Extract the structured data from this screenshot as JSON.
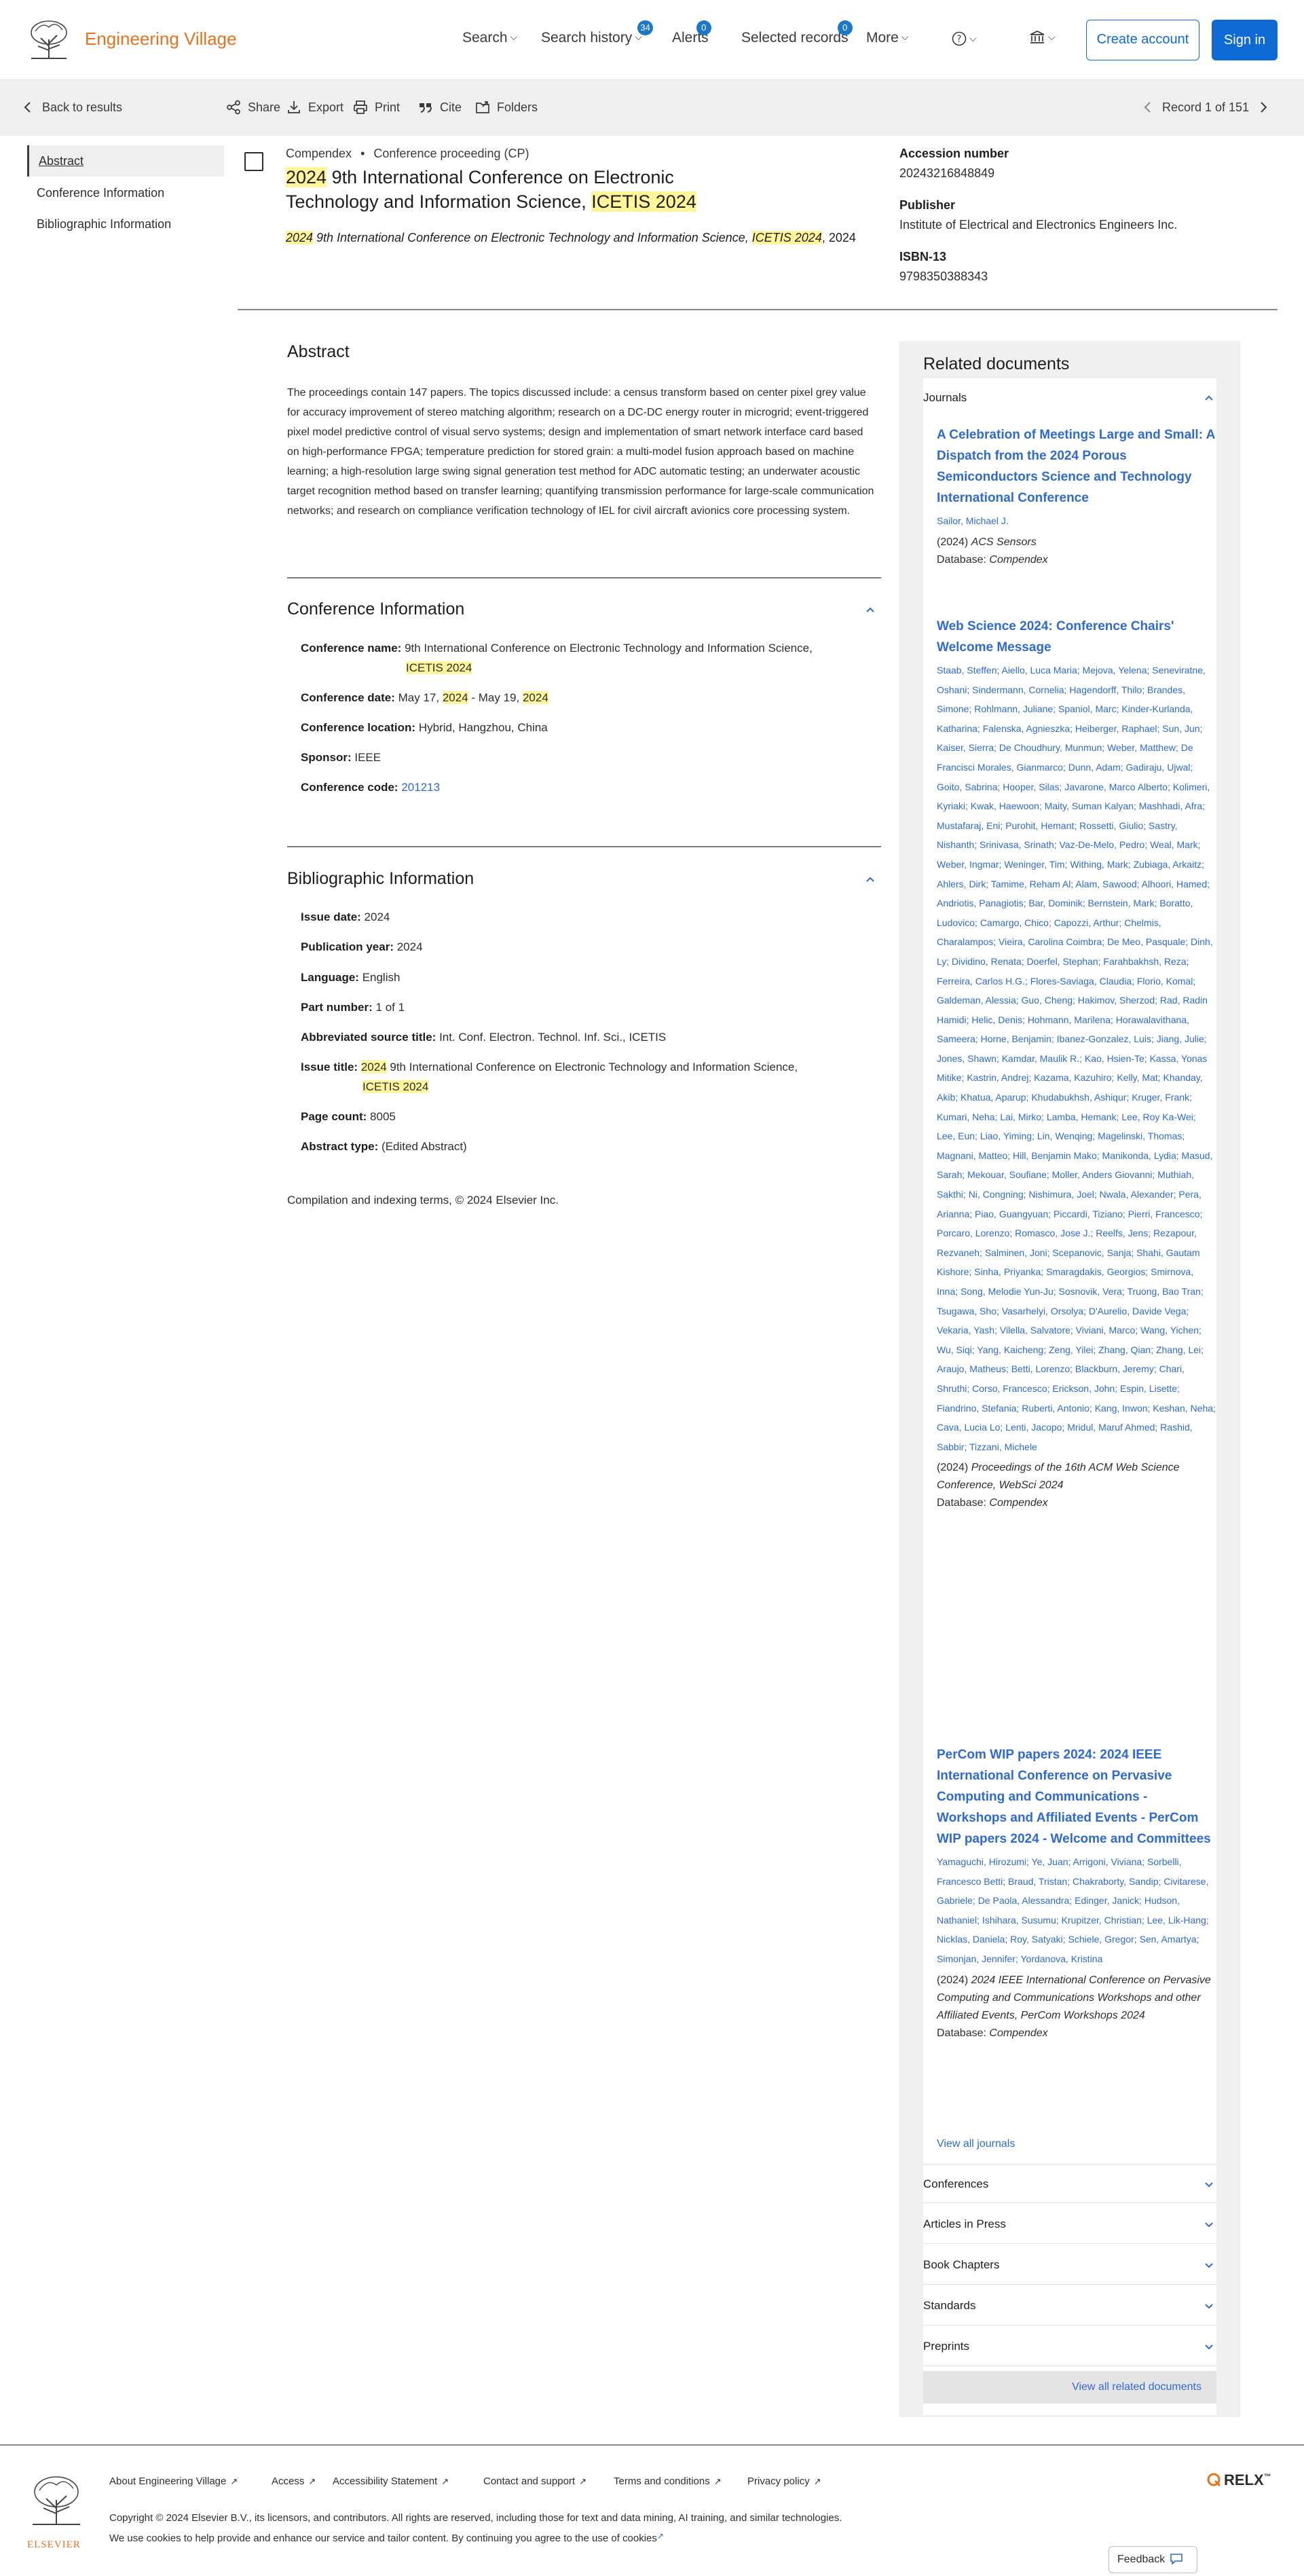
{
  "header": {
    "brand": "Engineering Village",
    "nav": {
      "search": "Search",
      "history": "Search history",
      "history_count": "34",
      "alerts": "Alerts",
      "alerts_count": "0",
      "selected": "Selected records",
      "selected_count": "0",
      "more": "More"
    },
    "create_account": "Create account",
    "sign_in": "Sign in"
  },
  "toolbar": {
    "back": "Back to results",
    "share": "Share",
    "export": "Export",
    "print": "Print",
    "cite": "Cite",
    "folders": "Folders",
    "record": "Record 1 of 151"
  },
  "sidebar": {
    "items": [
      "Abstract",
      "Conference Information",
      "Bibliographic Information"
    ]
  },
  "record": {
    "database": "Compendex",
    "sep": "•",
    "doc_type": "Conference proceeding (CP)",
    "title_hl1": "2024",
    "title_a": " 9th International Conference on Electronic Technology and Information Science, ",
    "title_hl2": "ICETIS 2024",
    "source_hl1": "2024",
    "source_a": " 9th International Conference on Electronic Technology and Information Science, ",
    "source_hl2": "ICETIS 2024",
    "source_b": ", 2024",
    "accession_label": "Accession number",
    "accession_value": "20243216848849",
    "publisher_label": "Publisher",
    "publisher_value": "Institute of Electrical and Electronics Engineers Inc.",
    "isbn_label": "ISBN-13",
    "isbn_value": "9798350388343"
  },
  "abstract": {
    "heading": "Abstract",
    "text": "The proceedings contain 147 papers. The topics discussed include: a census transform based on center pixel grey value for accuracy improvement of stereo matching algorithm; research on a DC-DC energy router in microgrid; event-triggered pixel model predictive control of visual servo systems; design and implementation of smart network interface card based on high-performance FPGA; temperature prediction for stored grain: a multi-model fusion approach based on machine learning; a high-resolution large swing signal generation test method for ADC automatic testing; an underwater acoustic target recognition method based on transfer learning; quantifying transmission performance for large-scale communication networks; and research on compliance verification technology of IEL for civil aircraft avionics core processing system."
  },
  "conference": {
    "heading": "Conference Information",
    "name_label": "Conference name:",
    "name_a": "9th International Conference on Electronic Technology and Information Science,",
    "name_hl": "ICETIS 2024",
    "date_label": "Conference date:",
    "date_a": "May 17, ",
    "date_hl1": "2024",
    "date_b": " - May 19, ",
    "date_hl2": "2024",
    "location_label": "Conference location:",
    "location": "Hybrid, Hangzhou, China",
    "sponsor_label": "Sponsor:",
    "sponsor": "IEEE",
    "code_label": "Conference code:",
    "code": "201213"
  },
  "biblio": {
    "heading": "Bibliographic Information",
    "issue_date_label": "Issue date:",
    "issue_date": "2024",
    "pub_year_label": "Publication year:",
    "pub_year": "2024",
    "language_label": "Language:",
    "language": "English",
    "part_label": "Part number:",
    "part": "1 of 1",
    "abbr_label": "Abbreviated source title:",
    "abbr": "Int. Conf. Electron. Technol. Inf. Sci., ICETIS",
    "issue_title_label": "Issue title:",
    "issue_title_hl1": "2024",
    "issue_title_a": " 9th International Conference on Electronic Technology and Information Science,",
    "issue_title_hl2": "ICETIS 2024",
    "page_count_label": "Page count:",
    "page_count": "8005",
    "abstract_type_label": "Abstract type:",
    "abstract_type": "(Edited Abstract)"
  },
  "copyright_line": "Compilation and indexing terms, © 2024 Elsevier Inc.",
  "related": {
    "heading": "Related documents",
    "journals_label": "Journals",
    "docs": [
      {
        "title": "A Celebration of Meetings Large and Small: A Dispatch from the 2024 Porous Semiconductors Science and Technology International Conference",
        "authors": "Sailor, Michael J.",
        "src_year": "(2024) ",
        "src_name": "ACS Sensors",
        "db_label": "Database: ",
        "db": "Compendex"
      },
      {
        "title": "Web Science 2024: Conference Chairs' Welcome Message",
        "authors": "Staab, Steffen; Aiello, Luca Maria; Mejova, Yelena; Seneviratne, Oshani; Sindermann, Cornelia; Hagendorff, Thilo; Brandes, Simone; Rohlmann, Juliane; Spaniol, Marc; Kinder-Kurlanda, Katharina; Falenska, Agnieszka; Heiberger, Raphael; Sun, Jun; Kaiser, Sierra; De Choudhury, Munmun; Weber, Matthew; De Francisci Morales, Gianmarco; Dunn, Adam; Gadiraju, Ujwal; Goito, Sabrina; Hooper, Silas; Javarone, Marco Alberto; Kolimeri, Kyriaki; Kwak, Haewoon; Maity, Suman Kalyan; Mashhadi, Afra; Mustafaraj, Eni; Purohit, Hemant; Rossetti, Giulio; Sastry, Nishanth; Srinivasa, Srinath; Vaz-De-Melo, Pedro; Weal, Mark; Weber, Ingmar; Weninger, Tim; Withing, Mark; Zubiaga, Arkaitz; Ahlers, Dirk; Tamime, Reham Al; Alam, Sawood; Alhoori, Hamed; Andriotis, Panagiotis; Bar, Dominik; Bernstein, Mark; Boratto, Ludovico; Camargo, Chico; Capozzi, Arthur; Chelmis, Charalampos; Vieira, Carolina Coimbra; De Meo, Pasquale; Dinh, Ly; Dividino, Renata; Doerfel, Stephan; Farahbakhsh, Reza; Ferreira, Carlos H.G.; Flores-Saviaga, Claudia; Florio, Komal; Galdeman, Alessia; Guo, Cheng; Hakimov, Sherzod; Rad, Radin Hamidi; Helic, Denis; Hohmann, Marilena; Horawalavithana, Sameera; Horne, Benjamin; Ibanez-Gonzalez, Luis; Jiang, Julie; Jones, Shawn; Kamdar, Maulik R.; Kao, Hsien-Te; Kassa, Yonas Mitike; Kastrin, Andrej; Kazama, Kazuhiro; Kelly, Mat; Khanday, Akib; Khatua, Aparup; Khudabukhsh, Ashiqur; Kruger, Frank; Kumari, Neha; Lai, Mirko; Lamba, Hemank; Lee, Roy Ka-Wei; Lee, Eun; Liao, Yiming; Lin, Wenqing; Magelinski, Thomas; Magnani, Matteo; Hill, Benjamin Mako; Manikonda, Lydia; Masud, Sarah; Mekouar, Soufiane; Moller, Anders Giovanni; Muthiah, Sakthi; Ni, Congning; Nishimura, Joel; Nwala, Alexander; Pera, Arianna; Piao, Guangyuan; Piccardi, Tiziano; Pierri, Francesco; Porcaro, Lorenzo; Romasco, Jose J.; Reelfs, Jens; Rezapour, Rezvaneh; Salminen, Joni; Scepanovic, Sanja; Shahi, Gautam Kishore; Sinha, Priyanka; Smaragdakis, Georgios; Smirnova, Inna; Song, Melodie Yun-Ju; Sosnovik, Vera; Truong, Bao Tran; Tsugawa, Sho; Vasarhelyi, Orsolya; D'Aurelio, Davide Vega; Vekaria, Yash; Vilella, Salvatore; Viviani, Marco; Wang, Yichen; Wu, Siqi; Yang, Kaicheng; Zeng, Yilei; Zhang, Qian; Zhang, Lei; Araujo, Matheus; Betti, Lorenzo; Blackburn, Jeremy; Chari, Shruthi; Corso, Francesco; Erickson, John; Espin, Lisette; Fiandrino, Stefania; Ruberti, Antonio; Kang, Inwon; Keshan, Neha; Cava, Lucia Lo; Lenti, Jacopo; Mridul, Maruf Ahmed; Rashid, Sabbir; Tizzani, Michele",
        "src_year": "(2024) ",
        "src_name": "Proceedings of the 16th ACM Web Science Conference, WebSci 2024",
        "db_label": "Database: ",
        "db": "Compendex"
      },
      {
        "title": "PerCom WIP papers 2024: 2024 IEEE International Conference on Pervasive Computing and Communications - Workshops and Affiliated Events - PerCom WIP papers 2024 - Welcome and Committees",
        "authors": "Yamaguchi, Hirozumi; Ye, Juan; Arrigoni, Viviana; Sorbelli, Francesco Betti; Braud, Tristan; Chakraborty, Sandip; Civitarese, Gabriele; De Paola, Alessandra; Edinger, Janick; Hudson, Nathaniel; Ishihara, Susumu; Krupitzer, Christian; Lee, Lik-Hang; Nicklas, Daniela; Roy, Satyaki; Schiele, Gregor; Sen, Amartya; Simonjan, Jennifer; Yordanova, Kristina",
        "src_year": "(2024) ",
        "src_name": "2024 IEEE International Conference on Pervasive Computing and Communications Workshops and other Affiliated Events, PerCom Workshops 2024",
        "db_label": "Database: ",
        "db": "Compendex"
      }
    ],
    "view_all_journals": "View all journals",
    "categories": [
      "Conferences",
      "Articles in Press",
      "Book Chapters",
      "Standards",
      "Preprints"
    ],
    "view_all_related": "View all related documents"
  },
  "footer": {
    "links": [
      "About Engineering Village",
      "Access",
      "Accessibility Statement",
      "Contact and support",
      "Terms and conditions",
      "Privacy policy"
    ],
    "copyright": "Copyright © 2024 Elsevier B.V., its licensors, and contributors. All rights are reserved, including those for text and data mining, AI training, and similar technologies.",
    "cookies": "We use cookies to help provide and enhance our service and tailor content. By continuing you agree to the use of cookies",
    "elsevier": "ELSEVIER",
    "relx": "RELX",
    "feedback": "Feedback"
  }
}
